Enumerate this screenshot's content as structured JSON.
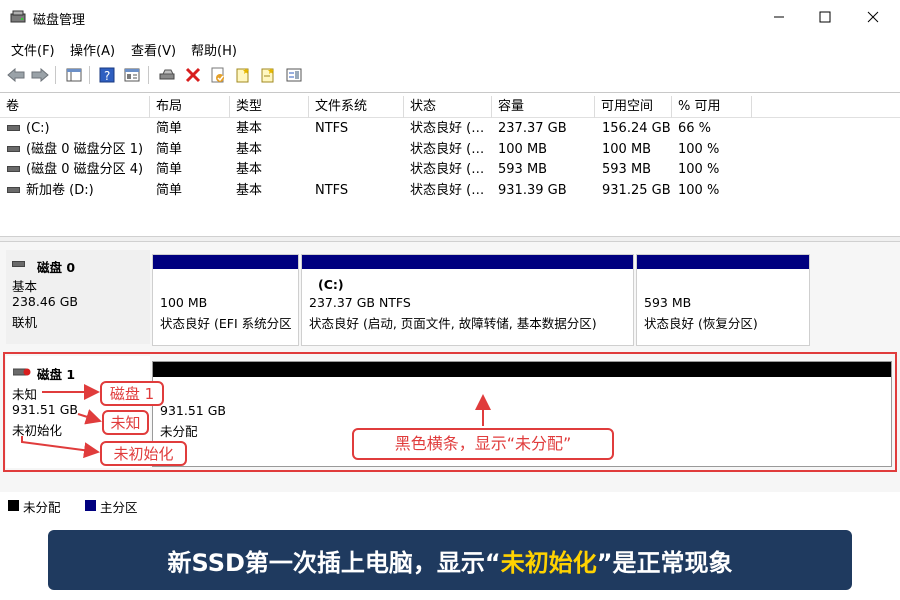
{
  "window": {
    "title": "磁盘管理"
  },
  "menu": [
    "文件(F)",
    "操作(A)",
    "查看(V)",
    "帮助(H)"
  ],
  "columns": [
    "卷",
    "布局",
    "类型",
    "文件系统",
    "状态",
    "容量",
    "可用空间",
    "% 可用"
  ],
  "volumes": [
    {
      "name": "(C:)",
      "layout": "简单",
      "type": "基本",
      "fs": "NTFS",
      "status": "状态良好 (…",
      "capacity": "237.37 GB",
      "free": "156.24 GB",
      "pct": "66 %"
    },
    {
      "name": "(磁盘 0 磁盘分区 1)",
      "layout": "简单",
      "type": "基本",
      "fs": "",
      "status": "状态良好 (…",
      "capacity": "100 MB",
      "free": "100 MB",
      "pct": "100 %"
    },
    {
      "name": "(磁盘 0 磁盘分区 4)",
      "layout": "简单",
      "type": "基本",
      "fs": "",
      "status": "状态良好 (…",
      "capacity": "593 MB",
      "free": "593 MB",
      "pct": "100 %"
    },
    {
      "name": "新加卷 (D:)",
      "layout": "简单",
      "type": "基本",
      "fs": "NTFS",
      "status": "状态良好 (…",
      "capacity": "931.39 GB",
      "free": "931.25 GB",
      "pct": "100 %"
    }
  ],
  "disk0": {
    "name": "磁盘 0",
    "type": "基本",
    "size": "238.46 GB",
    "status": "联机",
    "partitions": [
      {
        "label": "",
        "size": "100 MB",
        "status": "状态良好 (EFI 系统分区"
      },
      {
        "label": "(C:)",
        "size": "237.37 GB NTFS",
        "status": "状态良好 (启动, 页面文件, 故障转储, 基本数据分区)"
      },
      {
        "label": "",
        "size": "593 MB",
        "status": "状态良好 (恢复分区)"
      }
    ]
  },
  "disk1": {
    "name": "磁盘 1",
    "type": "未知",
    "size": "931.51 GB",
    "status": "未初始化",
    "partition": {
      "size": "931.51 GB",
      "status": "未分配"
    }
  },
  "callouts": {
    "disk": "磁盘 1",
    "unknown": "未知",
    "uninit": "未初始化",
    "bar": "黑色横条，显示“未分配”"
  },
  "legend": [
    {
      "label": "未分配",
      "color": "#000000"
    },
    {
      "label": "主分区",
      "color": "#00007f"
    }
  ],
  "banner": {
    "pre": "新SSD第一次插上电脑，显示“",
    "highlight": "未初始化",
    "post": "”是正常现象"
  },
  "colors": {
    "accent_red": "#e03c3c",
    "primary_partition": "#00007f",
    "banner_bg": "#1f3a5f",
    "highlight": "#ffd200"
  }
}
